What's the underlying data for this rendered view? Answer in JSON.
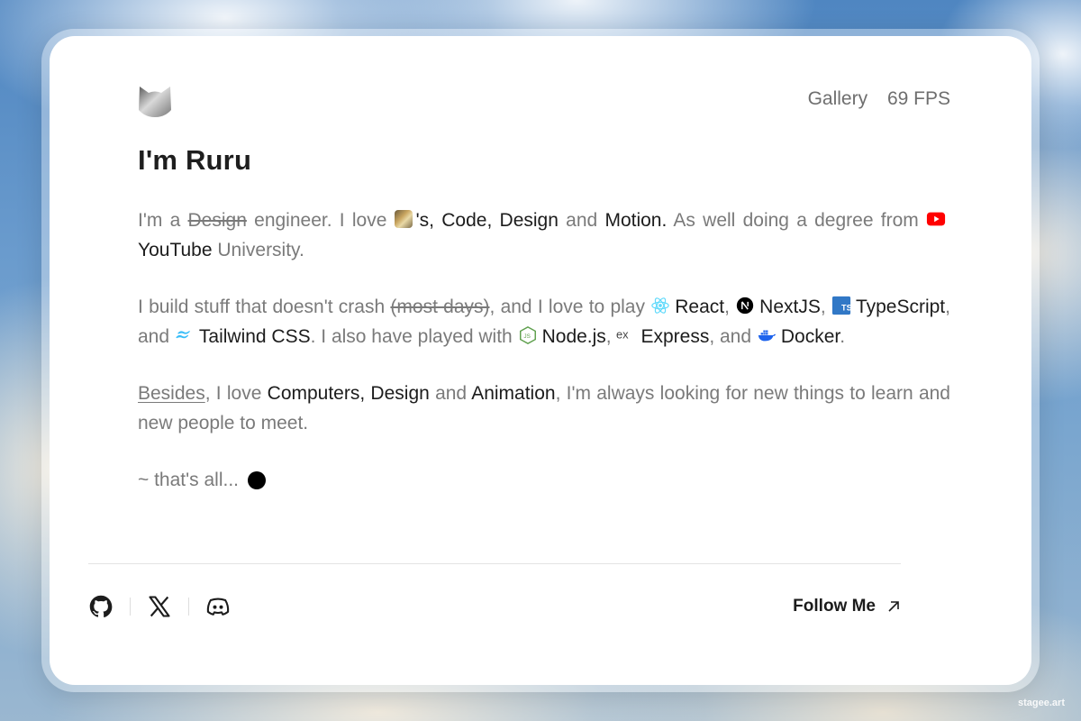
{
  "header": {
    "gallery_label": "Gallery",
    "fps_label": "69 FPS"
  },
  "title": "I'm Ruru",
  "intro": {
    "im_a": "I'm a",
    "design_struck": "Design",
    "engineer_love": "engineer. I love",
    "apostrophe_s": "'s,",
    "code": "Code,",
    "design": "Design",
    "and": "and",
    "motion": "Motion.",
    "as_well": "As well doing a degree from",
    "youtube": "YouTube",
    "university": "University."
  },
  "build": {
    "lead": "I build stuff that doesn't crash",
    "most_days": "(most days)",
    "play": ", and I love to play",
    "react": "React",
    "nextjs": "NextJS",
    "typescript": "TypeScript",
    "and1": ", and",
    "tailwind": "Tailwind CSS",
    "also": ". I also have played with",
    "node": "Node.js",
    "express": "Express",
    "and2": "and",
    "docker": "Docker"
  },
  "besides": {
    "besides": "Besides",
    "i_love": ", I love",
    "computers": "Computers, Design",
    "and": "and",
    "animation": "Animation",
    "rest": ", I'm always looking for new things to learn and new people to meet."
  },
  "thats_all": "~ that's all...",
  "footer": {
    "follow_label": "Follow Me",
    "social_icons": [
      "github-icon",
      "x-icon",
      "discord-icon"
    ]
  },
  "watermark": "stagee.art",
  "colors": {
    "text_dark": "#1c1c1c",
    "text_muted": "#7a7a7a",
    "youtube_red": "#ff0000",
    "react_blue": "#61dafb",
    "ts_blue": "#3178c6",
    "tailwind_cyan": "#38bdf8",
    "node_green": "#5fa04e",
    "docker_blue": "#1d63ed"
  }
}
